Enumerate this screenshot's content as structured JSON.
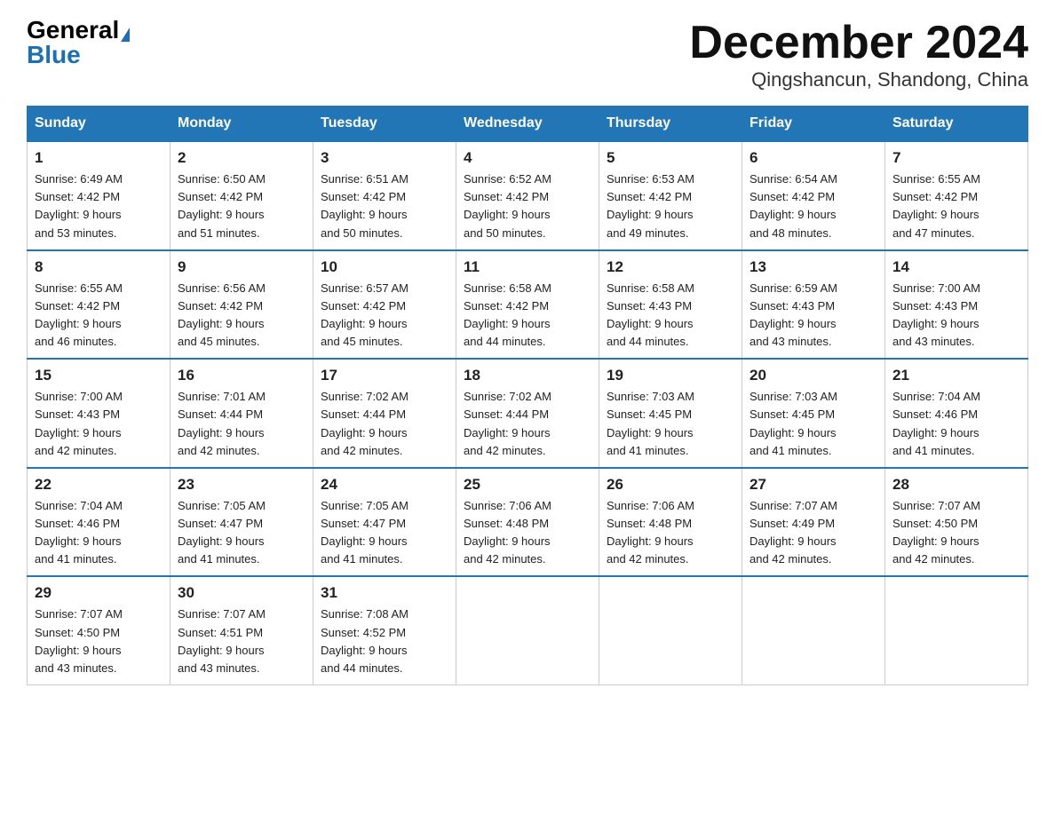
{
  "header": {
    "logo_general": "General",
    "logo_blue": "Blue",
    "month": "December 2024",
    "location": "Qingshancun, Shandong, China"
  },
  "weekdays": [
    "Sunday",
    "Monday",
    "Tuesday",
    "Wednesday",
    "Thursday",
    "Friday",
    "Saturday"
  ],
  "weeks": [
    [
      {
        "day": "1",
        "sunrise": "6:49 AM",
        "sunset": "4:42 PM",
        "daylight": "9 hours and 53 minutes."
      },
      {
        "day": "2",
        "sunrise": "6:50 AM",
        "sunset": "4:42 PM",
        "daylight": "9 hours and 51 minutes."
      },
      {
        "day": "3",
        "sunrise": "6:51 AM",
        "sunset": "4:42 PM",
        "daylight": "9 hours and 50 minutes."
      },
      {
        "day": "4",
        "sunrise": "6:52 AM",
        "sunset": "4:42 PM",
        "daylight": "9 hours and 50 minutes."
      },
      {
        "day": "5",
        "sunrise": "6:53 AM",
        "sunset": "4:42 PM",
        "daylight": "9 hours and 49 minutes."
      },
      {
        "day": "6",
        "sunrise": "6:54 AM",
        "sunset": "4:42 PM",
        "daylight": "9 hours and 48 minutes."
      },
      {
        "day": "7",
        "sunrise": "6:55 AM",
        "sunset": "4:42 PM",
        "daylight": "9 hours and 47 minutes."
      }
    ],
    [
      {
        "day": "8",
        "sunrise": "6:55 AM",
        "sunset": "4:42 PM",
        "daylight": "9 hours and 46 minutes."
      },
      {
        "day": "9",
        "sunrise": "6:56 AM",
        "sunset": "4:42 PM",
        "daylight": "9 hours and 45 minutes."
      },
      {
        "day": "10",
        "sunrise": "6:57 AM",
        "sunset": "4:42 PM",
        "daylight": "9 hours and 45 minutes."
      },
      {
        "day": "11",
        "sunrise": "6:58 AM",
        "sunset": "4:42 PM",
        "daylight": "9 hours and 44 minutes."
      },
      {
        "day": "12",
        "sunrise": "6:58 AM",
        "sunset": "4:43 PM",
        "daylight": "9 hours and 44 minutes."
      },
      {
        "day": "13",
        "sunrise": "6:59 AM",
        "sunset": "4:43 PM",
        "daylight": "9 hours and 43 minutes."
      },
      {
        "day": "14",
        "sunrise": "7:00 AM",
        "sunset": "4:43 PM",
        "daylight": "9 hours and 43 minutes."
      }
    ],
    [
      {
        "day": "15",
        "sunrise": "7:00 AM",
        "sunset": "4:43 PM",
        "daylight": "9 hours and 42 minutes."
      },
      {
        "day": "16",
        "sunrise": "7:01 AM",
        "sunset": "4:44 PM",
        "daylight": "9 hours and 42 minutes."
      },
      {
        "day": "17",
        "sunrise": "7:02 AM",
        "sunset": "4:44 PM",
        "daylight": "9 hours and 42 minutes."
      },
      {
        "day": "18",
        "sunrise": "7:02 AM",
        "sunset": "4:44 PM",
        "daylight": "9 hours and 42 minutes."
      },
      {
        "day": "19",
        "sunrise": "7:03 AM",
        "sunset": "4:45 PM",
        "daylight": "9 hours and 41 minutes."
      },
      {
        "day": "20",
        "sunrise": "7:03 AM",
        "sunset": "4:45 PM",
        "daylight": "9 hours and 41 minutes."
      },
      {
        "day": "21",
        "sunrise": "7:04 AM",
        "sunset": "4:46 PM",
        "daylight": "9 hours and 41 minutes."
      }
    ],
    [
      {
        "day": "22",
        "sunrise": "7:04 AM",
        "sunset": "4:46 PM",
        "daylight": "9 hours and 41 minutes."
      },
      {
        "day": "23",
        "sunrise": "7:05 AM",
        "sunset": "4:47 PM",
        "daylight": "9 hours and 41 minutes."
      },
      {
        "day": "24",
        "sunrise": "7:05 AM",
        "sunset": "4:47 PM",
        "daylight": "9 hours and 41 minutes."
      },
      {
        "day": "25",
        "sunrise": "7:06 AM",
        "sunset": "4:48 PM",
        "daylight": "9 hours and 42 minutes."
      },
      {
        "day": "26",
        "sunrise": "7:06 AM",
        "sunset": "4:48 PM",
        "daylight": "9 hours and 42 minutes."
      },
      {
        "day": "27",
        "sunrise": "7:07 AM",
        "sunset": "4:49 PM",
        "daylight": "9 hours and 42 minutes."
      },
      {
        "day": "28",
        "sunrise": "7:07 AM",
        "sunset": "4:50 PM",
        "daylight": "9 hours and 42 minutes."
      }
    ],
    [
      {
        "day": "29",
        "sunrise": "7:07 AM",
        "sunset": "4:50 PM",
        "daylight": "9 hours and 43 minutes."
      },
      {
        "day": "30",
        "sunrise": "7:07 AM",
        "sunset": "4:51 PM",
        "daylight": "9 hours and 43 minutes."
      },
      {
        "day": "31",
        "sunrise": "7:08 AM",
        "sunset": "4:52 PM",
        "daylight": "9 hours and 44 minutes."
      },
      null,
      null,
      null,
      null
    ]
  ],
  "labels": {
    "sunrise": "Sunrise:",
    "sunset": "Sunset:",
    "daylight": "Daylight:"
  }
}
